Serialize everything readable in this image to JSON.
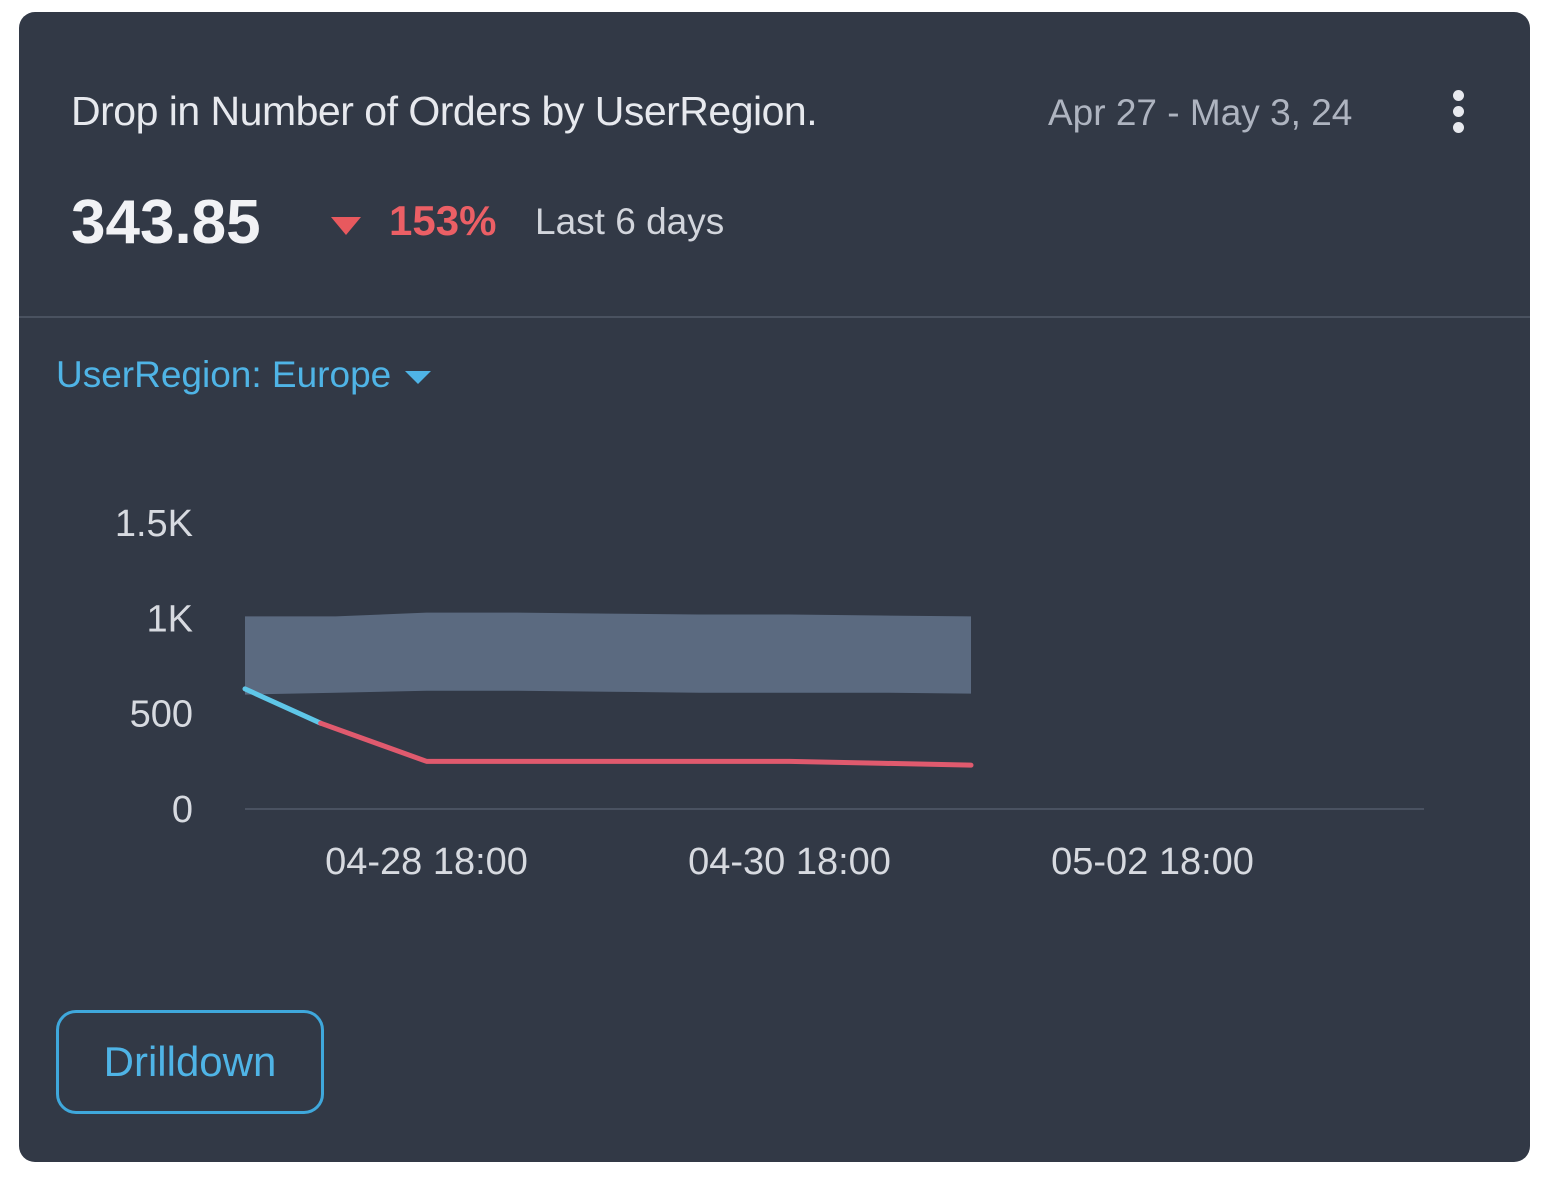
{
  "widget": {
    "title": "Drop in Number of Orders by UserRegion.",
    "date_range": "Apr 27 - May 3, 24",
    "more_icon": "more-vertical-icon"
  },
  "metric": {
    "value": "343.85",
    "change": "153%",
    "change_direction": "down",
    "period": "Last 6 days",
    "change_color": "#ec5f65"
  },
  "filter": {
    "label": "UserRegion: Europe",
    "caret_icon": "caret-down-icon"
  },
  "actions": {
    "drilldown_label": "Drilldown"
  },
  "colors": {
    "card_bg": "#323946",
    "accent": "#4fb4e6",
    "band": "#5b6a80",
    "line_normal": "#5fc7e8",
    "line_anomaly": "#e05a6e"
  },
  "chart_data": {
    "type": "line",
    "title": "",
    "xlabel": "",
    "ylabel": "",
    "ylim": [
      0,
      1500
    ],
    "y_ticks": [
      {
        "value": 0,
        "label": "0"
      },
      {
        "value": 500,
        "label": "500"
      },
      {
        "value": 1000,
        "label": "1K"
      },
      {
        "value": 1500,
        "label": "1.5K"
      }
    ],
    "x_ticks": [
      "04-28 18:00",
      "04-30 18:00",
      "05-02 18:00"
    ],
    "grid": false,
    "series": [
      {
        "kind": "band",
        "x": [
          "04-27 18:00",
          "04-28 06:00",
          "04-28 18:00",
          "04-29 06:00",
          "04-29 18:00",
          "04-30 06:00",
          "04-30 18:00",
          "05-01 06:00",
          "05-01 18:00"
        ],
        "upper": [
          1010,
          1010,
          1030,
          1030,
          1025,
          1020,
          1020,
          1015,
          1010
        ],
        "lower": [
          600,
          610,
          620,
          620,
          615,
          610,
          610,
          610,
          605
        ]
      },
      {
        "kind": "line",
        "segment": "normal",
        "x": [
          "04-27 18:00",
          "04-28 04:00"
        ],
        "values": [
          630,
          450
        ]
      },
      {
        "kind": "line",
        "segment": "anomaly",
        "x": [
          "04-28 04:00",
          "04-28 18:00",
          "04-29 06:00",
          "04-30 18:00",
          "05-01 06:00",
          "05-01 18:00"
        ],
        "values": [
          450,
          250,
          250,
          250,
          240,
          230
        ]
      }
    ]
  }
}
